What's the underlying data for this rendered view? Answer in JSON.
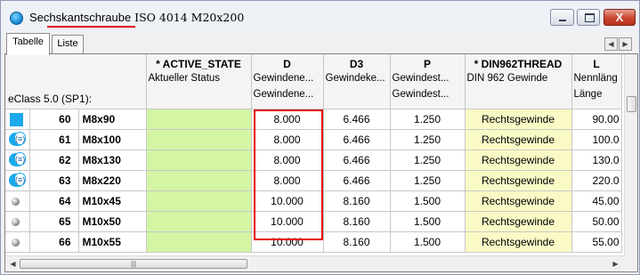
{
  "window": {
    "title_part1": "Sechskantschraube",
    "title_part2": " ISO 4014 M20x200",
    "close_label": "X"
  },
  "tabs": [
    {
      "label": "Tabelle",
      "active": true
    },
    {
      "label": "Liste",
      "active": false
    }
  ],
  "grid": {
    "corner_label": "eClass 5.0 (SP1):",
    "columns": [
      {
        "code": "* ACTIVE_STATE",
        "line1": "Aktueller Status",
        "line2": ""
      },
      {
        "code": "D",
        "line1": "Gewindene...",
        "line2": "Gewindene..."
      },
      {
        "code": "D3",
        "line1": "Gewindeke...",
        "line2": ""
      },
      {
        "code": "P",
        "line1": "Gewindest...",
        "line2": "Gewindest..."
      },
      {
        "code": "* DIN962THREAD",
        "line1": "DIN 962 Gewinde",
        "line2": ""
      },
      {
        "code": "L",
        "line1": "Nennläng",
        "line2": "Länge"
      }
    ],
    "rows": [
      {
        "icon": "square",
        "num": "60",
        "name": "M8x90",
        "active_state": "",
        "d": "8.000",
        "d3": "6.466",
        "p": "1.250",
        "thread": "Rechtsgewinde",
        "l": "90.00"
      },
      {
        "icon": "pill",
        "num": "61",
        "name": "M8x100",
        "active_state": "",
        "d": "8.000",
        "d3": "6.466",
        "p": "1.250",
        "thread": "Rechtsgewinde",
        "l": "100.0"
      },
      {
        "icon": "pill",
        "num": "62",
        "name": "M8x130",
        "active_state": "",
        "d": "8.000",
        "d3": "6.466",
        "p": "1.250",
        "thread": "Rechtsgewinde",
        "l": "130.0"
      },
      {
        "icon": "pill",
        "num": "63",
        "name": "M8x220",
        "active_state": "",
        "d": "8.000",
        "d3": "6.466",
        "p": "1.250",
        "thread": "Rechtsgewinde",
        "l": "220.0"
      },
      {
        "icon": "ball",
        "num": "64",
        "name": "M10x45",
        "active_state": "",
        "d": "10.000",
        "d3": "8.160",
        "p": "1.500",
        "thread": "Rechtsgewinde",
        "l": "45.00"
      },
      {
        "icon": "ball",
        "num": "65",
        "name": "M10x50",
        "active_state": "",
        "d": "10.000",
        "d3": "8.160",
        "p": "1.500",
        "thread": "Rechtsgewinde",
        "l": "50.00"
      },
      {
        "icon": "ball",
        "num": "66",
        "name": "M10x55",
        "active_state": "",
        "d": "10.000",
        "d3": "8.160",
        "p": "1.500",
        "thread": "Rechtsgewinde",
        "l": "55.00"
      }
    ]
  },
  "icons": {
    "pill_glyph": "(≡)",
    "hthumb_grip": "|||"
  },
  "colors": {
    "active_state_cell": "#d3f5a4",
    "thread_cell": "#fafac6",
    "highlight": "#e30000",
    "status_blue": "#1ba9eb"
  }
}
